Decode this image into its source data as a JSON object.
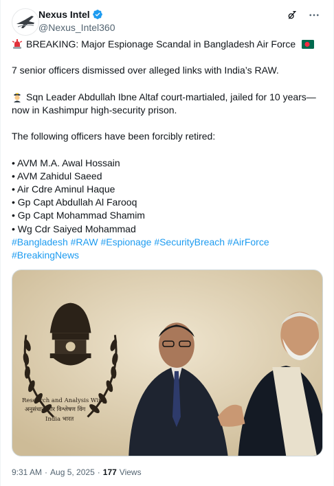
{
  "author": {
    "name": "Nexus Intel",
    "handle": "@Nexus_Intel360",
    "verified": true,
    "avatar_icon": "jet-fighter-logo-icon"
  },
  "actions": {
    "grok_icon": "grok-icon",
    "more_icon": "more-icon"
  },
  "post": {
    "line1": "BREAKING: Major Espionage Scandal in Bangladesh Air Force",
    "line2": "7 senior officers dismissed over alleged links with India’s RAW.",
    "line3a": "Sqn Leader Abdullah Ibne Altaf court-martialed, jailed for 10 years—",
    "line3b": "now in Kashimpur high-security prison.",
    "line4": "The following officers have been forcibly retired:",
    "officers": [
      "• AVM M.A. Awal Hossain",
      "• AVM Zahidul Saeed",
      "• Air Cdre Aminul Haque",
      "• Gp Capt Abdullah Al Farooq",
      "• Gp Capt Mohammad Shamim",
      "• Wg Cdr Saiyed Mohammad"
    ],
    "hashtags_line1": [
      "#Bangladesh",
      "#RAW",
      "#Espionage",
      "#SecurityBreach",
      "#AirForce"
    ],
    "hashtags_line2": [
      "#BreakingNews"
    ]
  },
  "media": {
    "caption_line1": "Research and Analysis Wing",
    "caption_line2": "अनुसंधान और विश्लेषण विंग",
    "caption_line3": "India भारत"
  },
  "meta": {
    "time": "9:31 AM",
    "sep1": "·",
    "date": "Aug 5, 2025",
    "sep2": "·",
    "views_count": "177",
    "views_label": "Views"
  },
  "colors": {
    "link": "#1d9bf0",
    "secondary_text": "#536471",
    "verified": "#1d9bf0"
  }
}
